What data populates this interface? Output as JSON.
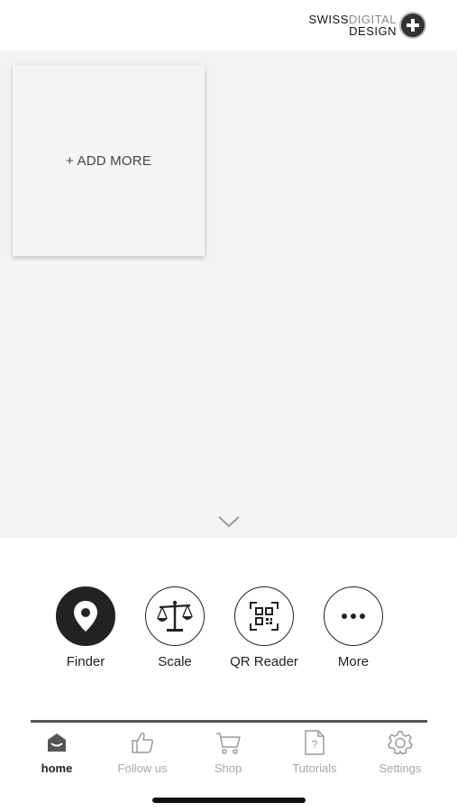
{
  "header": {
    "logo": {
      "word1": "SWISS",
      "word2": "DIGITAL",
      "word3": "DESIGN"
    }
  },
  "main": {
    "add_card_label": "+ ADD MORE",
    "expand_icon": "chevron-down-icon"
  },
  "quick_actions": [
    {
      "label": "Finder",
      "icon": "location-pin-icon"
    },
    {
      "label": "Scale",
      "icon": "scale-icon"
    },
    {
      "label": "QR Reader",
      "icon": "qr-code-icon"
    },
    {
      "label": "More",
      "icon": "more-dots-icon"
    }
  ],
  "tabs": [
    {
      "label": "home",
      "icon": "home-icon",
      "active": true
    },
    {
      "label": "Follow us",
      "icon": "thumbs-up-icon",
      "active": false
    },
    {
      "label": "Shop",
      "icon": "cart-icon",
      "active": false
    },
    {
      "label": "Tutorials",
      "icon": "help-document-icon",
      "active": false
    },
    {
      "label": "Settings",
      "icon": "gear-icon",
      "active": false
    }
  ],
  "colors": {
    "canvas_bg": "#f2f3f5",
    "icon_dark": "#222222",
    "tab_inactive": "#a7a7a7"
  }
}
